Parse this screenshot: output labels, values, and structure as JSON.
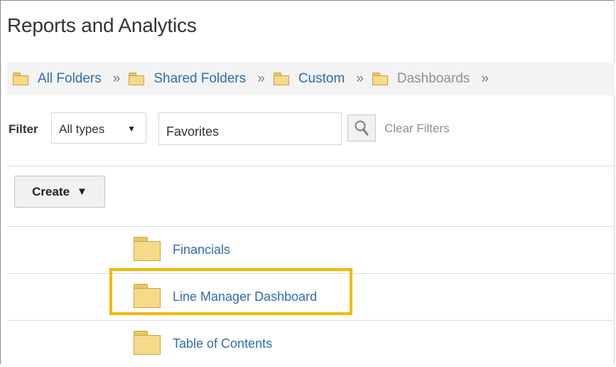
{
  "header": {
    "title": "Reports and Analytics"
  },
  "breadcrumb": {
    "items": [
      {
        "label": "All Folders"
      },
      {
        "label": "Shared Folders"
      },
      {
        "label": "Custom"
      },
      {
        "label": "Dashboards"
      }
    ],
    "separator": "»"
  },
  "filter": {
    "label": "Filter",
    "type_value": "All types",
    "search_value": "Favorites",
    "clear_label": "Clear Filters"
  },
  "toolbar": {
    "create_label": "Create"
  },
  "folders": [
    {
      "label": "Financials"
    },
    {
      "label": "Line Manager Dashboard",
      "highlighted": true
    },
    {
      "label": "Table of Contents"
    }
  ],
  "colors": {
    "link": "#2e6eb0",
    "highlight": "#f5b800",
    "folder": "#f6d98a"
  }
}
